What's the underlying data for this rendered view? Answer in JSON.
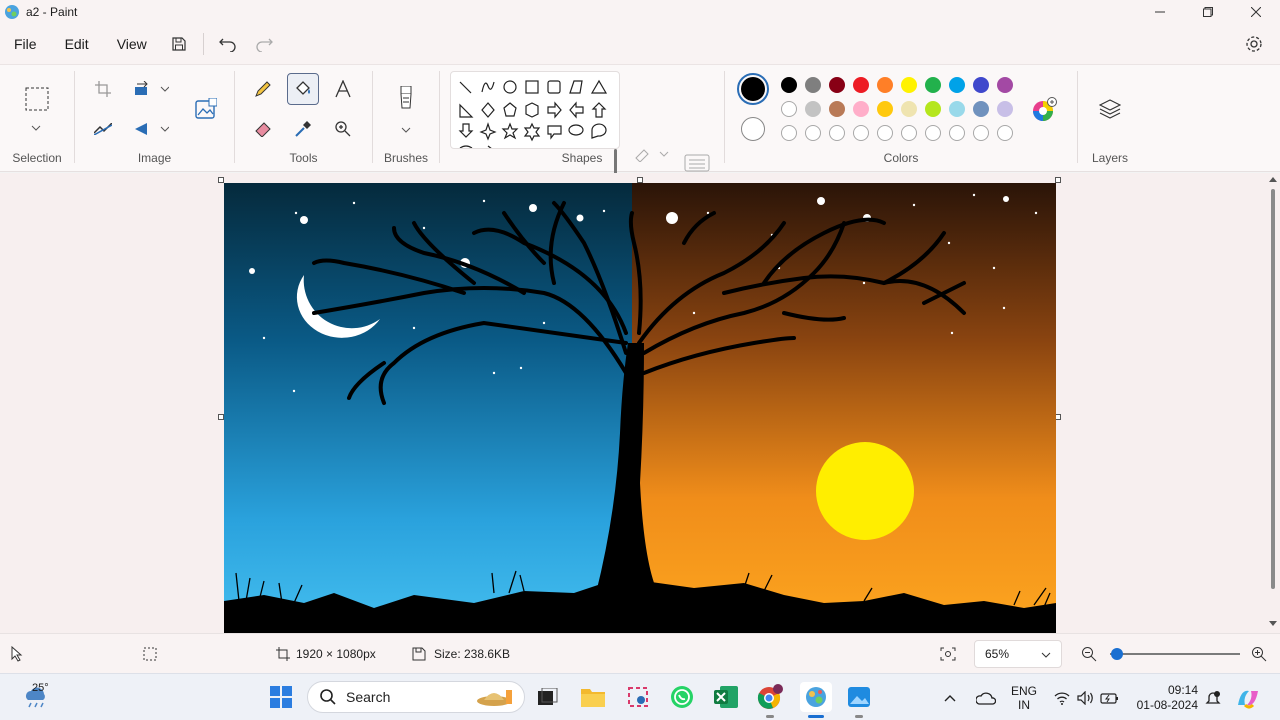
{
  "window": {
    "title": "a2 - Paint",
    "controls": [
      "minimize",
      "maximize",
      "close"
    ]
  },
  "menu": {
    "file": "File",
    "edit": "Edit",
    "view": "View"
  },
  "ribbon": {
    "groups": {
      "selection": "Selection",
      "image": "Image",
      "tools": "Tools",
      "brushes": "Brushes",
      "shapes": "Shapes",
      "colors": "Colors",
      "layers": "Layers"
    },
    "active_tool": "fill",
    "current_colors": {
      "primary": "#000000",
      "secondary": "#ffffff"
    },
    "palette_row1": [
      "#000000",
      "#7f7f7f",
      "#880015",
      "#ed1c24",
      "#ff7f27",
      "#fff200",
      "#22b14c",
      "#00a2e8",
      "#3f48cc",
      "#a349a4"
    ],
    "palette_row2": [
      "#ffffff",
      "#c3c3c3",
      "#b97a57",
      "#ffaec9",
      "#ffc90e",
      "#efe4b0",
      "#b5e61d",
      "#99d9ea",
      "#7092be",
      "#c8bfe7"
    ],
    "custom_slots": 10
  },
  "status": {
    "dimensions": "1920 × 1080px",
    "size": "Size: 238.6KB",
    "zoom": "65%",
    "zoom_level": 0.05
  },
  "taskbar": {
    "weather": "25°",
    "search_placeholder": "Search",
    "lang_line1": "ENG",
    "lang_line2": "IN",
    "time": "09:14",
    "date": "01-08-2024",
    "apps": [
      "start",
      "search",
      "task-view",
      "file-explorer",
      "snipping-tool",
      "whatsapp",
      "excel",
      "chrome",
      "paint",
      "photos"
    ]
  }
}
